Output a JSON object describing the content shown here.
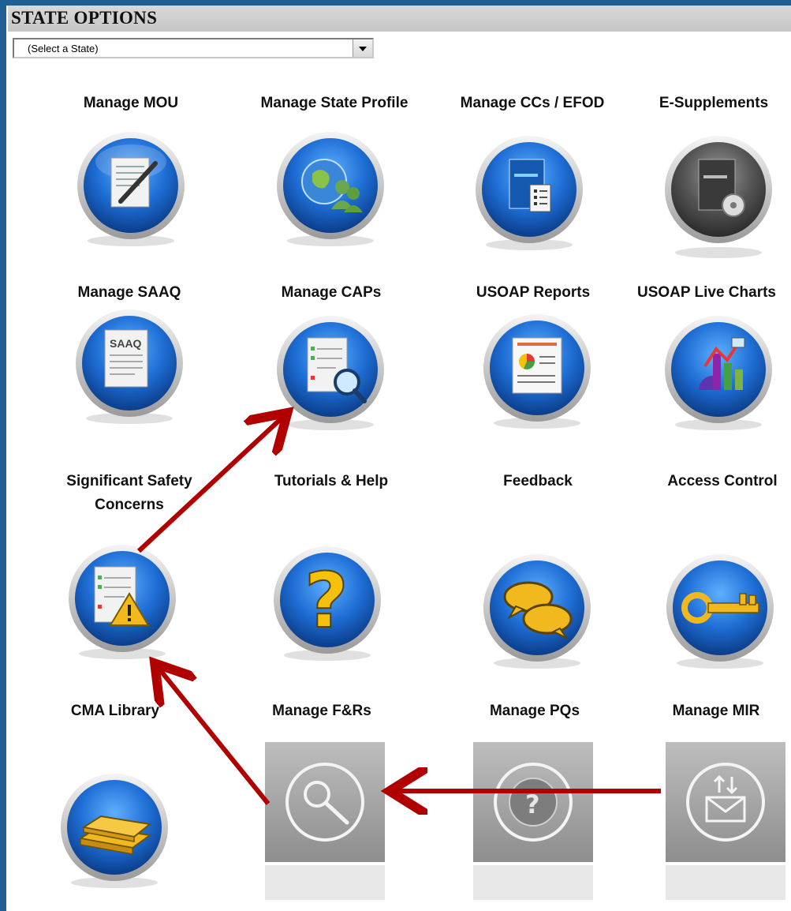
{
  "header": {
    "title": "STATE OPTIONS"
  },
  "state_select": {
    "selected": "(Select a State)"
  },
  "tiles": [
    {
      "label": "Manage MOU",
      "icon": "document-pen-icon",
      "style": "blue"
    },
    {
      "label": "Manage State Profile",
      "icon": "globe-people-icon",
      "style": "blue"
    },
    {
      "label": "Manage CCs / EFOD",
      "icon": "book-checklist-icon",
      "style": "blue"
    },
    {
      "label": "E-Supplements",
      "icon": "book-cd-icon",
      "style": "gray"
    },
    {
      "label": "Manage SAAQ",
      "icon": "saaq-document-icon",
      "style": "blue"
    },
    {
      "label": "Manage CAPs",
      "icon": "document-magnifier-icon",
      "style": "blue"
    },
    {
      "label": "USOAP Reports",
      "icon": "report-pie-icon",
      "style": "blue"
    },
    {
      "label": "USOAP Live Charts",
      "icon": "charts-icon",
      "style": "blue"
    },
    {
      "label": "Significant Safety Concerns",
      "icon": "document-warning-icon",
      "style": "blue"
    },
    {
      "label": "Tutorials & Help",
      "icon": "question-mark-icon",
      "style": "blue"
    },
    {
      "label": "Feedback",
      "icon": "speech-bubbles-icon",
      "style": "blue"
    },
    {
      "label": "Access Control",
      "icon": "key-icon",
      "style": "blue"
    },
    {
      "label": "CMA Library",
      "icon": "books-icon",
      "style": "blue"
    },
    {
      "label": "Manage F&Rs",
      "icon": "magnifier-icon",
      "style": "square"
    },
    {
      "label": "Manage PQs",
      "icon": "globe-question-icon",
      "style": "square"
    },
    {
      "label": "Manage MIR",
      "icon": "envelope-arrows-icon",
      "style": "square"
    }
  ],
  "colors": {
    "frame": "#1f5f93",
    "arrow": "#b00000",
    "blue_icon": "#1f6fd6",
    "gray_icon": "#555555"
  }
}
